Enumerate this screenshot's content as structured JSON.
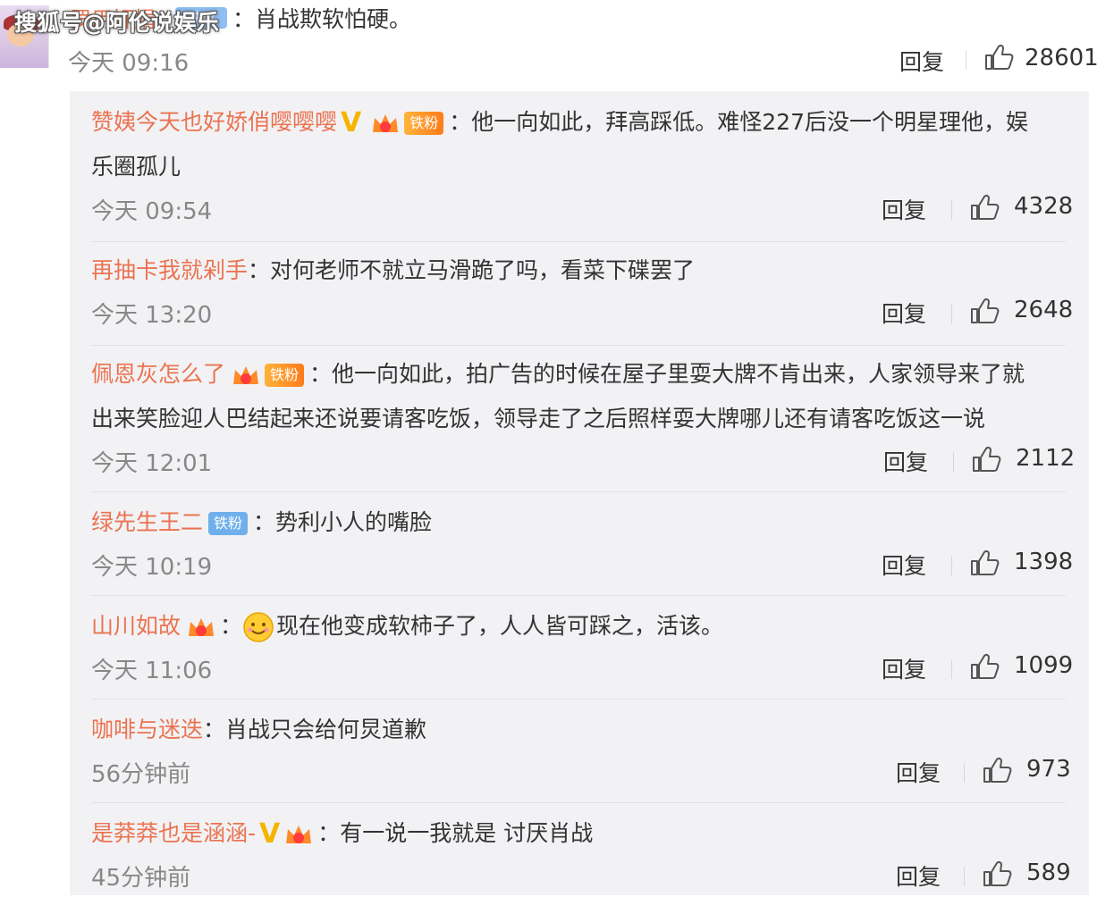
{
  "watermark": "搜狐号@阿伦说娱乐",
  "top_comment": {
    "name": "罗用奸娟",
    "badge": "铁粉",
    "text": "：肖战欺软怕硬。",
    "time": "今天 09:16",
    "reply": "回复",
    "likes": "28601"
  },
  "replies": [
    {
      "name": "赞姨今天也好娇俏嘤嘤嘤",
      "badge": "铁粉",
      "text": "：他一向如此，拜高踩低。难怪227后没一个明星理他，娱",
      "text2": "乐圈孤儿",
      "time": "今天 09:54",
      "reply": "回复",
      "likes": "4328"
    },
    {
      "name": "再抽卡我就剁手",
      "text": "：对何老师不就立马滑跪了吗，看菜下碟罢了",
      "time": "今天 13:20",
      "reply": "回复",
      "likes": "2648"
    },
    {
      "name": "佩恩灰怎么了",
      "badge": "铁粉",
      "text": "：他一向如此，拍广告的时候在屋子里耍大牌不肯出来，人家领导来了就",
      "text2": "出来笑脸迎人巴结起来还说要请客吃饭，领导走了之后照样耍大牌哪儿还有请客吃饭这一说",
      "time": "今天 12:01",
      "reply": "回复",
      "likes": "2112"
    },
    {
      "name": "绿先生王二",
      "badge": "铁粉",
      "text": "：势利小人的嘴脸",
      "time": "今天 10:19",
      "reply": "回复",
      "likes": "1398"
    },
    {
      "name": "山川如故",
      "colon": "：",
      "text": "现在他变成软柿子了，人人皆可踩之，活该。",
      "time": "今天 11:06",
      "reply": "回复",
      "likes": "1099"
    },
    {
      "name": "咖啡与迷迭",
      "text": "：肖战只会给何炅道歉",
      "time": "56分钟前",
      "reply": "回复",
      "likes": "973"
    },
    {
      "name": "是莽莽也是涵涵-",
      "text": "：有一说一我就是 讨厌肖战",
      "time": "45分钟前",
      "reply": "回复",
      "likes": "589"
    }
  ],
  "colors": {
    "name": "#eb7350",
    "panel": "#f2f2f5",
    "vip": "#f6b400",
    "fan_badge": "#ff8a2a"
  }
}
